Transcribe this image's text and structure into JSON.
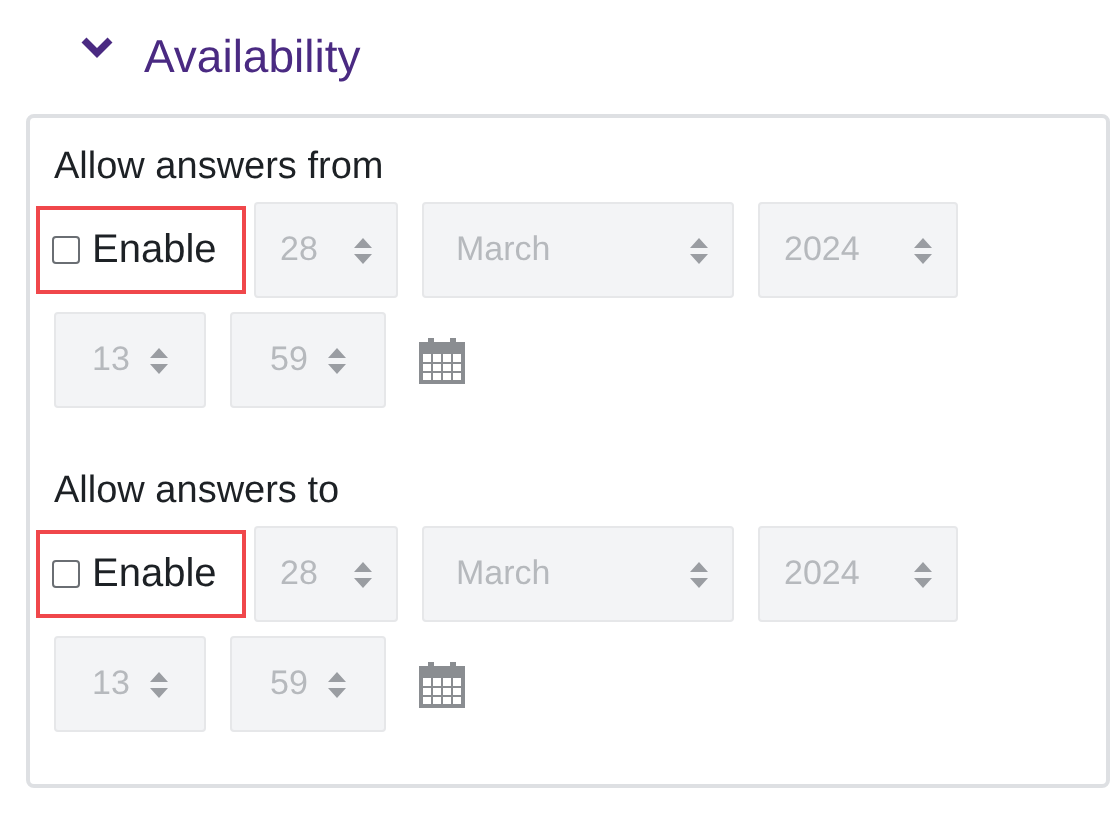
{
  "section": {
    "title": "Availability",
    "expanded": true
  },
  "fields": [
    {
      "label": "Allow answers from",
      "enable": {
        "label": "Enable",
        "checked": false,
        "highlighted": true
      },
      "disabled": true,
      "day": "28",
      "month": "March",
      "year": "2024",
      "hour": "13",
      "minute": "59"
    },
    {
      "label": "Allow answers to",
      "enable": {
        "label": "Enable",
        "checked": false,
        "highlighted": true
      },
      "disabled": true,
      "day": "28",
      "month": "March",
      "year": "2024",
      "hour": "13",
      "minute": "59"
    }
  ]
}
